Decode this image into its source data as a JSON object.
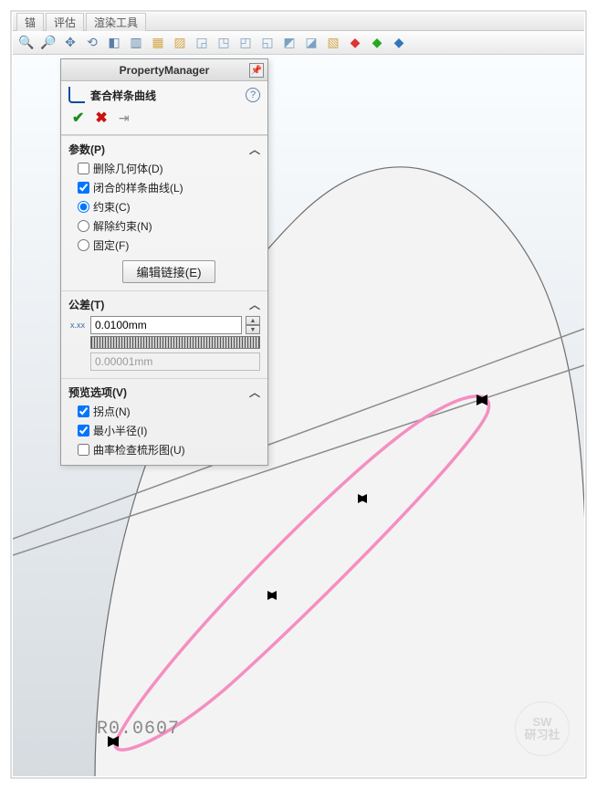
{
  "tabs": {
    "t1": "锚",
    "t2": "评估",
    "t3": "渲染工具"
  },
  "pm": {
    "title": "PropertyManager",
    "feature": "套合样条曲线",
    "params": {
      "header": "参数(P)",
      "delete_geom": "删除几何体(D)",
      "closed_spline": "闭合的样条曲线(L)",
      "constrain": "约束(C)",
      "unconstrain": "解除约束(N)",
      "fixed": "固定(F)",
      "edit_links": "编辑链接(E)"
    },
    "tolerance": {
      "header": "公差(T)",
      "value": "0.0100mm",
      "min": "0.00001mm"
    },
    "preview": {
      "header": "预览选项(V)",
      "inflection": "拐点(N)",
      "min_radius": "最小半径(I)",
      "curvature_comb": "曲率检查梳形图(U)"
    }
  },
  "canvas": {
    "radius_label": "R0.0607"
  },
  "watermark": {
    "line1": "SW",
    "line2": "研习社"
  }
}
